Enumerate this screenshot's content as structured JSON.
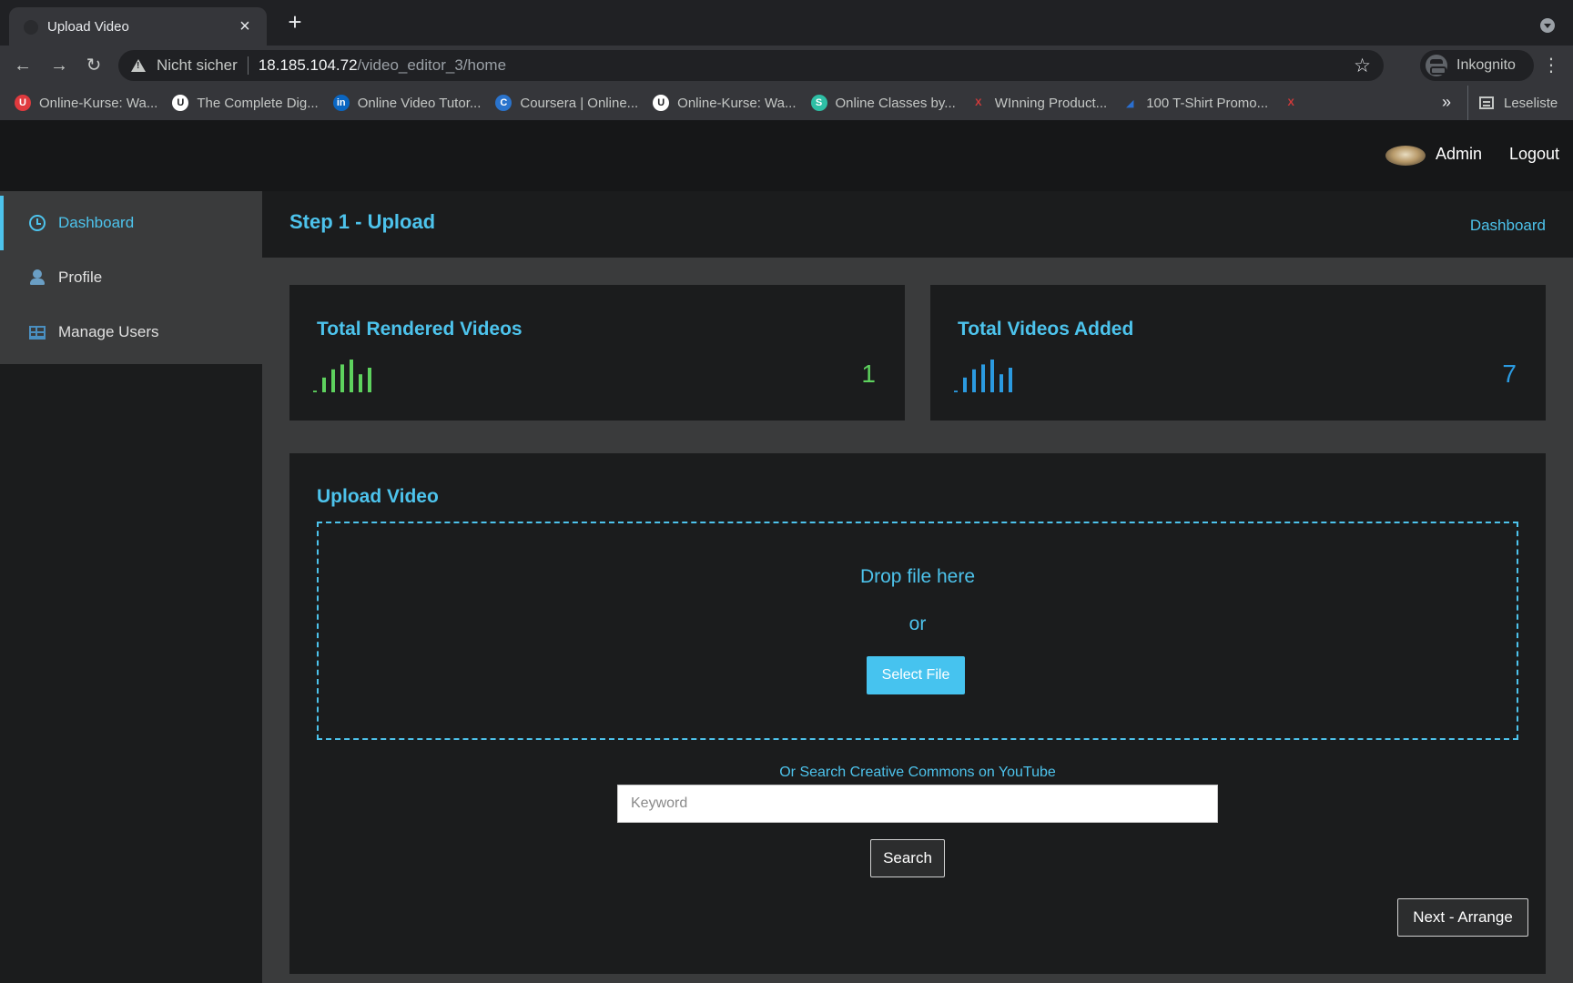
{
  "browser": {
    "tab_title": "Upload Video",
    "close_glyph": "×",
    "new_tab_glyph": "+",
    "not_secure": "Nicht sicher",
    "url_host": "18.185.104.72",
    "url_path": "/video_editor_3/home",
    "star_glyph": "☆",
    "profile_label": "Inkognito",
    "back_glyph": "←",
    "forward_glyph": "→",
    "reload_glyph": "↻",
    "menu_glyph": "⋮",
    "bookmarks": [
      {
        "label": "Online-Kurse: Wa...",
        "icon": "udemy-icon",
        "icon_glyph": "U",
        "color": "#e03a3e"
      },
      {
        "label": "The Complete Dig...",
        "icon": "udemy-icon",
        "icon_glyph": "U",
        "color": "#ffffff"
      },
      {
        "label": "Online Video Tutor...",
        "icon": "linkedin-icon",
        "icon_glyph": "in",
        "color": "#0a66c2"
      },
      {
        "label": "Coursera | Online...",
        "icon": "coursera-icon",
        "icon_glyph": "C",
        "color": "#2a73cc"
      },
      {
        "label": "Online-Kurse: Wa...",
        "icon": "udemy-icon",
        "icon_glyph": "U",
        "color": "#ffffff"
      },
      {
        "label": "Online Classes by...",
        "icon": "skillshare-icon",
        "icon_glyph": "S",
        "color": "#2ebfa5"
      },
      {
        "label": "WInning Product...",
        "icon": "bookmark-icon",
        "icon_glyph": "X",
        "color": "#d23a3a"
      },
      {
        "label": "100 T-Shirt Promo...",
        "icon": "bookmark-icon",
        "icon_glyph": "◢",
        "color": "#2a6fd0"
      }
    ],
    "extra_bookmark_icon_glyph": "X",
    "more_glyph": "»",
    "reading_list": "Leseliste"
  },
  "header": {
    "user_name": "Admin",
    "logout_label": "Logout"
  },
  "sidebar": {
    "items": [
      {
        "label": "Dashboard",
        "icon": "clock-icon",
        "active": true
      },
      {
        "label": "Profile",
        "icon": "user-icon",
        "active": false
      },
      {
        "label": "Manage Users",
        "icon": "table-icon",
        "active": false
      }
    ]
  },
  "page": {
    "title": "Step 1 - Upload",
    "breadcrumb": "Dashboard"
  },
  "stats": [
    {
      "title": "Total Rendered Videos",
      "value": "1",
      "color": "#5ed25e",
      "bars": [
        0.05,
        0.45,
        0.7,
        0.85,
        1.0,
        0.55,
        0.75
      ]
    },
    {
      "title": "Total Videos Added",
      "value": "7",
      "color": "#2b9ae0",
      "bars": [
        0.05,
        0.45,
        0.7,
        0.85,
        1.0,
        0.55,
        0.75
      ]
    }
  ],
  "upload": {
    "title": "Upload Video",
    "drop_text": "Drop file here",
    "or_text": "or",
    "select_label": "Select File",
    "cc_label": "Or Search Creative Commons on YouTube",
    "keyword_placeholder": "Keyword",
    "search_label": "Search",
    "next_label": "Next - Arrange"
  },
  "colors": {
    "accent": "#4dc3ec",
    "green": "#5ed25e",
    "blue": "#2b9ae0"
  }
}
